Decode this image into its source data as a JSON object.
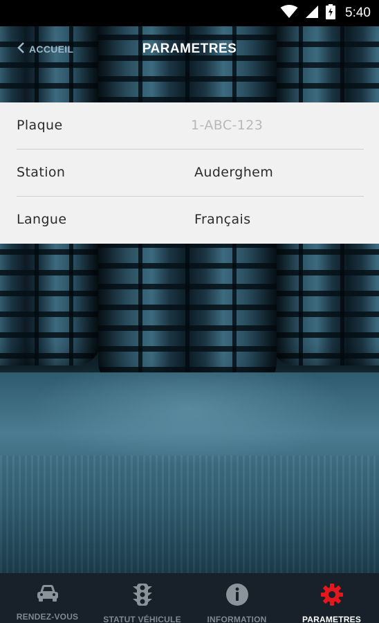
{
  "status_bar": {
    "time": "5:40"
  },
  "header": {
    "back_label": "ACCUEIL",
    "title": "PARAMETRES"
  },
  "settings": {
    "rows": [
      {
        "label": "Plaque",
        "value": "1-ABC-123"
      },
      {
        "label": "Station",
        "value": "Auderghem"
      },
      {
        "label": "Langue",
        "value": "Français"
      }
    ]
  },
  "bottom_nav": {
    "items": [
      {
        "label": "RENDEZ-VOUS",
        "icon": "car-icon"
      },
      {
        "label": "STATUT VÉHICULE",
        "icon": "traffic-light-icon"
      },
      {
        "label": "INFORMATION",
        "icon": "info-icon"
      },
      {
        "label": "PARAMETRES",
        "icon": "gear-icon",
        "active": true
      }
    ],
    "active_color": "#e3171c",
    "inactive_color": "#8a929a"
  }
}
